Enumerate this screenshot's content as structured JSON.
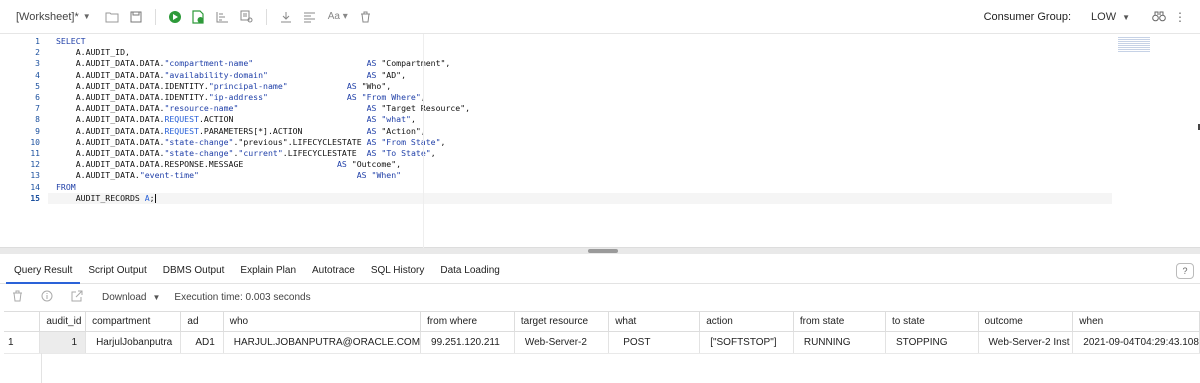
{
  "toolbar": {
    "worksheet_title": "[Worksheet]*",
    "consumer_group_label": "Consumer Group:",
    "consumer_group_value": "LOW"
  },
  "editor": {
    "line_numbers": [
      "1",
      "2",
      "3",
      "4",
      "5",
      "6",
      "7",
      "8",
      "9",
      "10",
      "11",
      "12",
      "13",
      "14",
      "15"
    ],
    "lines": [
      [
        {
          "t": "SELECT",
          "c": "kw"
        }
      ],
      [
        {
          "t": "    A.AUDIT_ID,",
          "c": ""
        }
      ],
      [
        {
          "t": "    A.AUDIT_DATA.DATA.",
          "c": ""
        },
        {
          "t": "\"compartment-name\"",
          "c": "str"
        },
        {
          "t": "                       ",
          "c": ""
        },
        {
          "t": "AS",
          "c": "kw"
        },
        {
          "t": " \"Compartment\",",
          "c": ""
        }
      ],
      [
        {
          "t": "    A.AUDIT_DATA.DATA.",
          "c": ""
        },
        {
          "t": "\"availability-domain\"",
          "c": "str"
        },
        {
          "t": "                    ",
          "c": ""
        },
        {
          "t": "AS",
          "c": "kw"
        },
        {
          "t": " \"AD\",",
          "c": ""
        }
      ],
      [
        {
          "t": "    A.AUDIT_DATA.DATA.IDENTITY.",
          "c": ""
        },
        {
          "t": "\"principal-name\"",
          "c": "str"
        },
        {
          "t": "            ",
          "c": ""
        },
        {
          "t": "AS",
          "c": "kw"
        },
        {
          "t": " \"Who\",",
          "c": ""
        }
      ],
      [
        {
          "t": "    A.AUDIT_DATA.DATA.IDENTITY.",
          "c": ""
        },
        {
          "t": "\"ip-address\"",
          "c": "str"
        },
        {
          "t": "                ",
          "c": ""
        },
        {
          "t": "AS",
          "c": "kw"
        },
        {
          "t": " ",
          "c": ""
        },
        {
          "t": "\"From Where\"",
          "c": "str"
        },
        {
          "t": ",",
          "c": ""
        }
      ],
      [
        {
          "t": "    A.AUDIT_DATA.DATA.",
          "c": ""
        },
        {
          "t": "\"resource-name\"",
          "c": "str"
        },
        {
          "t": "                          ",
          "c": ""
        },
        {
          "t": "AS",
          "c": "kw"
        },
        {
          "t": " \"Target Resource\",",
          "c": ""
        }
      ],
      [
        {
          "t": "    A.AUDIT_DATA.DATA.",
          "c": ""
        },
        {
          "t": "REQUEST",
          "c": "hl"
        },
        {
          "t": ".ACTION                           ",
          "c": ""
        },
        {
          "t": "AS",
          "c": "kw"
        },
        {
          "t": " ",
          "c": ""
        },
        {
          "t": "\"what\"",
          "c": "str"
        },
        {
          "t": ",",
          "c": ""
        }
      ],
      [
        {
          "t": "    A.AUDIT_DATA.DATA.",
          "c": ""
        },
        {
          "t": "REQUEST",
          "c": "hl"
        },
        {
          "t": ".PARAMETERS[*].ACTION             ",
          "c": ""
        },
        {
          "t": "AS",
          "c": "kw"
        },
        {
          "t": " \"Action\",",
          "c": ""
        }
      ],
      [
        {
          "t": "    A.AUDIT_DATA.DATA.",
          "c": ""
        },
        {
          "t": "\"state-change\"",
          "c": "str"
        },
        {
          "t": ".\"previous\".LIFECYCLESTATE ",
          "c": ""
        },
        {
          "t": "AS",
          "c": "kw"
        },
        {
          "t": " ",
          "c": ""
        },
        {
          "t": "\"From State\"",
          "c": "str"
        },
        {
          "t": ",",
          "c": ""
        }
      ],
      [
        {
          "t": "    A.AUDIT_DATA.DATA.",
          "c": ""
        },
        {
          "t": "\"state-change\"",
          "c": "str"
        },
        {
          "t": ".",
          "c": ""
        },
        {
          "t": "\"current\"",
          "c": "str"
        },
        {
          "t": ".LIFECYCLESTATE  ",
          "c": ""
        },
        {
          "t": "AS",
          "c": "kw"
        },
        {
          "t": " ",
          "c": ""
        },
        {
          "t": "\"To State\"",
          "c": "str"
        },
        {
          "t": ",",
          "c": ""
        }
      ],
      [
        {
          "t": "    A.AUDIT_DATA.DATA.RESPONSE.MESSAGE                   ",
          "c": ""
        },
        {
          "t": "AS",
          "c": "kw"
        },
        {
          "t": " \"Outcome\",",
          "c": ""
        }
      ],
      [
        {
          "t": "    A.AUDIT_DATA.",
          "c": ""
        },
        {
          "t": "\"event-time\"",
          "c": "str"
        },
        {
          "t": "                                ",
          "c": ""
        },
        {
          "t": "AS",
          "c": "kw"
        },
        {
          "t": " ",
          "c": ""
        },
        {
          "t": "\"When\"",
          "c": "str"
        }
      ],
      [
        {
          "t": "FROM",
          "c": "kw"
        }
      ],
      [
        {
          "t": "    AUDIT_RECORDS ",
          "c": ""
        },
        {
          "t": "A",
          "c": "hl"
        },
        {
          "t": ";",
          "c": ""
        }
      ]
    ]
  },
  "tabs": [
    "Query Result",
    "Script Output",
    "DBMS Output",
    "Explain Plan",
    "Autotrace",
    "SQL History",
    "Data Loading"
  ],
  "result_toolbar": {
    "download_label": "Download",
    "execution_time": "Execution time: 0.003 seconds"
  },
  "result_grid": {
    "columns": [
      "audit_id",
      "compartment",
      "ad",
      "who",
      "from where",
      "target resource",
      "what",
      "action",
      "from state",
      "to state",
      "outcome",
      "when"
    ],
    "rows": [
      {
        "row_number": "1",
        "cells": [
          "1",
          "HarjulJobanputra",
          "AD1",
          "HARJUL.JOBANPUTRA@ORACLE.COM",
          "99.251.120.211",
          "Web-Server-2",
          "POST",
          "[\"SOFTSTOP\"]",
          "RUNNING",
          "STOPPING",
          "Web-Server-2 Inst",
          "2021-09-04T04:29:43.108"
        ]
      }
    ]
  },
  "colors": {
    "accent": "#2a62d8",
    "keyword": "#1f3fa8",
    "run_green": "#2e9a3a"
  }
}
